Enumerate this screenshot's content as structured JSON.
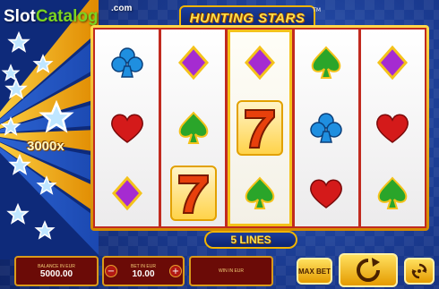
{
  "watermark": {
    "part1": "Slot",
    "part2": "Catalog",
    "suffix": ".com"
  },
  "title": "HUNTING STARS",
  "title_mark": "TM",
  "multiplier": "3000x",
  "lines_label": "5 LINES",
  "reels": [
    [
      "club",
      "heart",
      "diamond"
    ],
    [
      "diamond",
      "spade",
      "seven"
    ],
    [
      "diamond",
      "seven",
      "spade"
    ],
    [
      "spade",
      "club",
      "heart"
    ],
    [
      "diamond",
      "heart",
      "spade"
    ]
  ],
  "highlighted_reel": 2,
  "balance": {
    "label": "BALANCE IN EUR",
    "value": "5000.00"
  },
  "bet": {
    "label": "BET IN EUR",
    "value": "10.00",
    "minus": "−",
    "plus": "+"
  },
  "win": {
    "label": "WIN IN EUR",
    "value": ""
  },
  "maxbet_label": "MAX BET",
  "colors": {
    "club": "#1f8fe0",
    "diamond": "#a52bd1",
    "heart": "#d41a1a",
    "spade": "#2aa52a",
    "seven": "#e8400c"
  }
}
